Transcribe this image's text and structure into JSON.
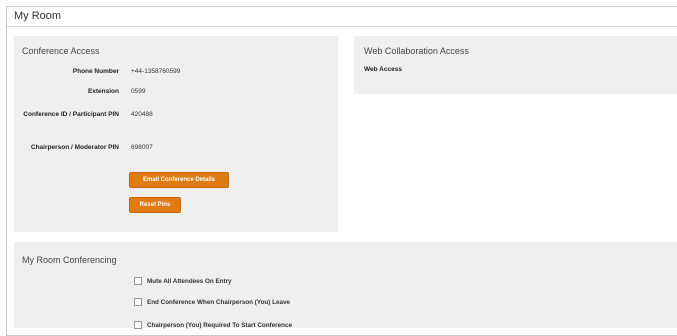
{
  "page": {
    "title": "My Room"
  },
  "conference_access": {
    "heading": "Conference Access",
    "fields": [
      {
        "label": "Phone Number",
        "value": "+44-1358760599"
      },
      {
        "label": "Extension",
        "value": "0599"
      },
      {
        "label": "Conference ID / Participant PIN",
        "value": "420488"
      },
      {
        "label": "Chairperson / Moderator PIN",
        "value": "698007"
      }
    ],
    "buttons": {
      "email_details": "Email Conference Details",
      "reset_pins": "Reset Pins"
    }
  },
  "web_collaboration": {
    "heading": "Web Collaboration Access",
    "web_access_label": "Web Access"
  },
  "my_room_conferencing": {
    "heading": "My Room Conferencing",
    "options": [
      {
        "label": "Mute All Attendees On Entry",
        "checked": false
      },
      {
        "label": "End Conference When Chairperson (You) Leave",
        "checked": false
      },
      {
        "label": "Chairperson (You) Required To Start Conference",
        "checked": false
      }
    ]
  },
  "colors": {
    "accent": "#e07a12",
    "panel_bg": "#efefef"
  }
}
